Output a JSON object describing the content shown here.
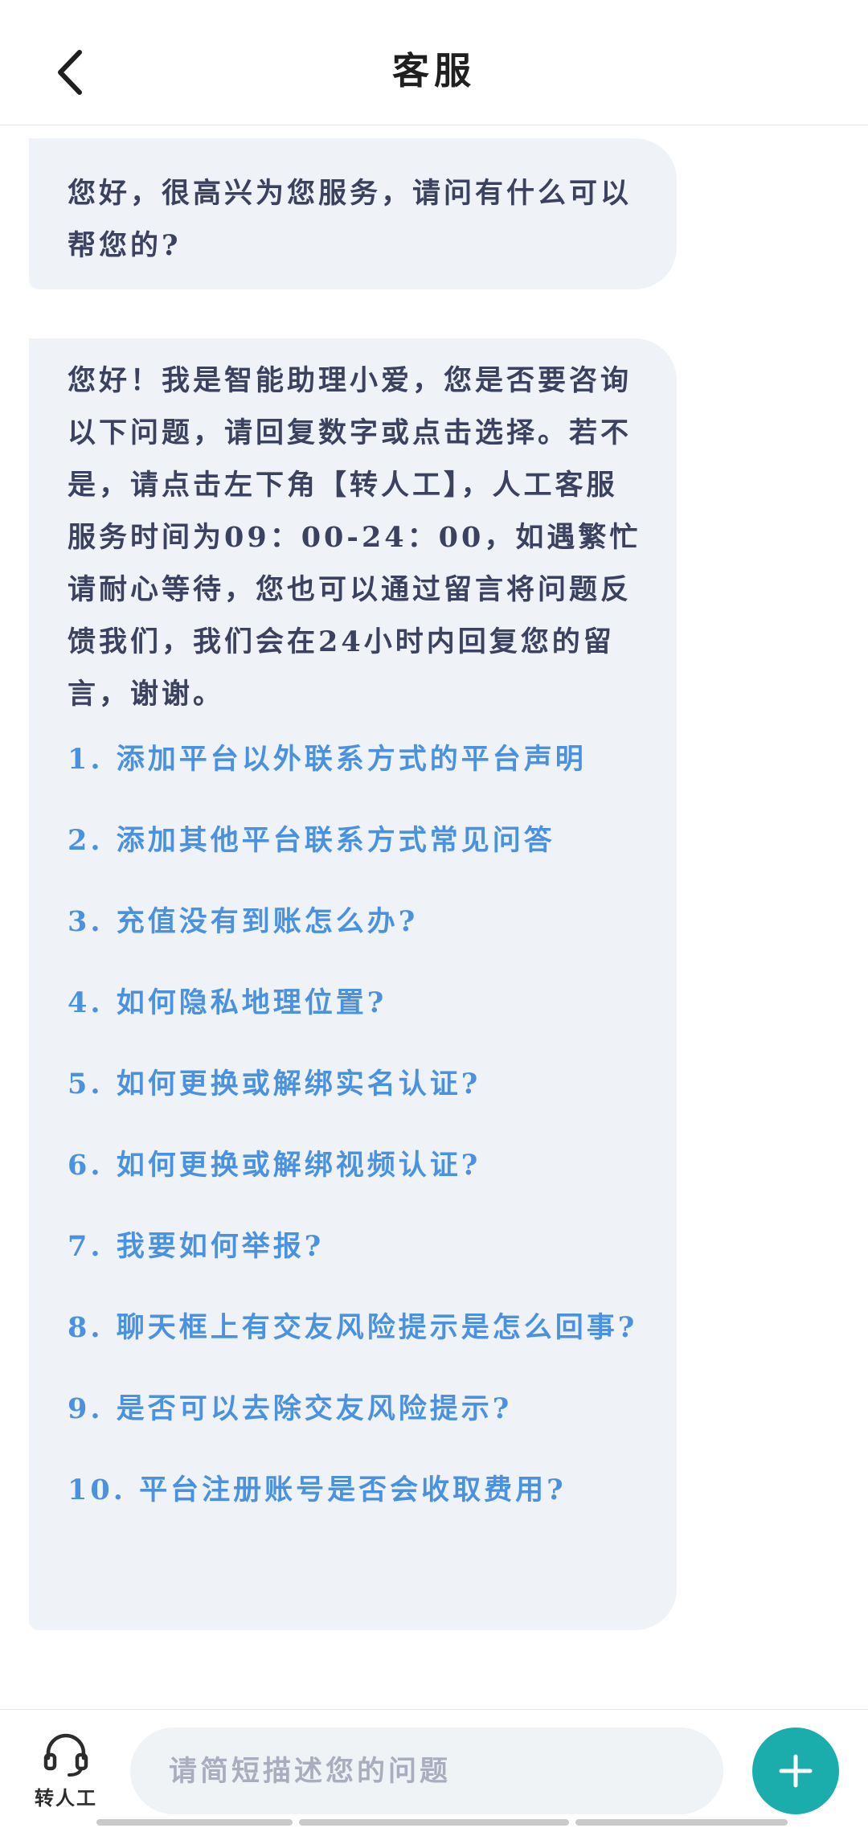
{
  "header": {
    "title": "客服"
  },
  "messages": [
    {
      "text": "您好，很高兴为您服务，请问有什么可以帮您的?"
    },
    {
      "text": "您好！我是智能助理小爱，您是否要咨询以下问题，请回复数字或点击选择。若不是，请点击左下角【转人工】，人工客服服务时间为09：00-24：00，如遇繁忙请耐心等待，您也可以通过留言将问题反馈我们，我们会在24小时内回复您的留言，谢谢。",
      "options": [
        "1. 添加平台以外联系方式的平台声明",
        "2. 添加其他平台联系方式常见问答",
        "3. 充值没有到账怎么办?",
        "4. 如何隐私地理位置?",
        "5. 如何更换或解绑实名认证?",
        "6. 如何更换或解绑视频认证?",
        "7. 我要如何举报?",
        "8. 聊天框上有交友风险提示是怎么回事?",
        "9. 是否可以去除交友风险提示?",
        "10. 平台注册账号是否会收取费用?"
      ]
    }
  ],
  "footer": {
    "human_label": "转人工",
    "input_placeholder": "请简短描述您的问题",
    "input_value": ""
  },
  "colors": {
    "accent": "#1aadab",
    "link": "#4a92e0",
    "bubble": "#eff3f7"
  },
  "icons": {
    "back": "chevron-left-icon",
    "human": "headset-icon",
    "plus": "plus-icon"
  }
}
